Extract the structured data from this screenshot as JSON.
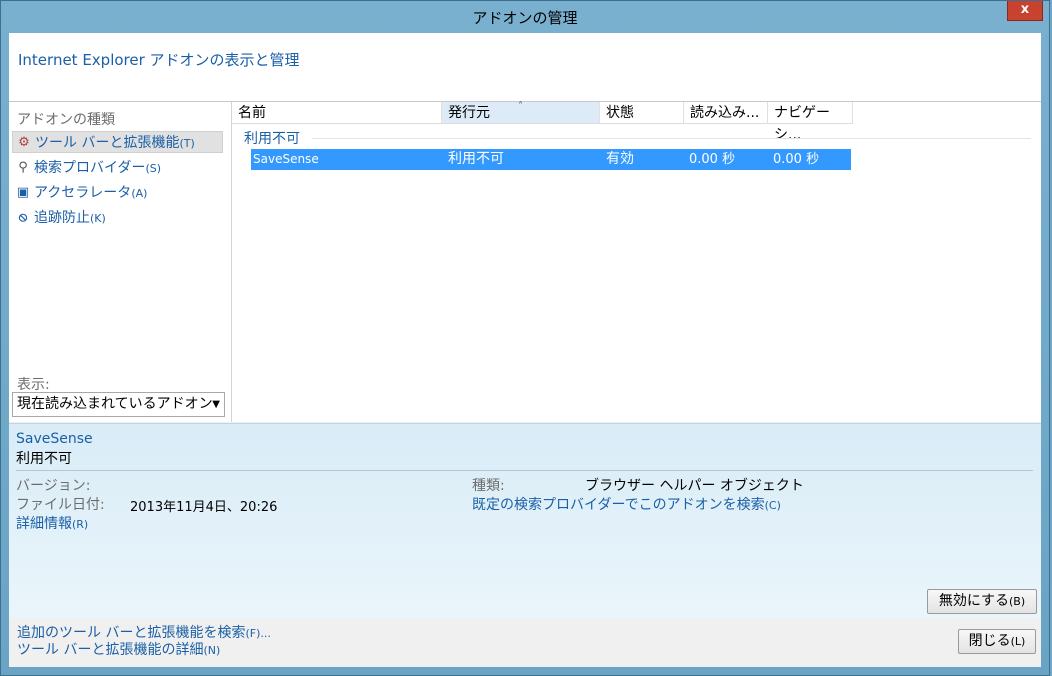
{
  "window": {
    "title": "アドオンの管理",
    "close_label": "x"
  },
  "header": {
    "title": "Internet Explorer アドオンの表示と管理"
  },
  "sidebar": {
    "heading": "アドオンの種類",
    "items": [
      {
        "label": "ツール バーと拡張機能",
        "accel": "(T)",
        "icon": "toolbar-extension-icon",
        "glyph": "⚙"
      },
      {
        "label": "検索プロバイダー",
        "accel": "(S)",
        "icon": "search-icon",
        "glyph": "⚲"
      },
      {
        "label": "アクセラレータ",
        "accel": "(A)",
        "icon": "accelerator-icon",
        "glyph": "▣"
      },
      {
        "label": "追跡防止",
        "accel": "(K)",
        "icon": "tracking-protection-icon",
        "glyph": "⦸"
      }
    ],
    "show_label": "表示:",
    "show_value": "現在読み込まれているアドオン"
  },
  "list": {
    "columns": [
      "名前",
      "発行元",
      "状態",
      "読み込み...",
      "ナビゲーシ..."
    ],
    "sorted_column": "発行元",
    "group": "利用不可",
    "rows": [
      {
        "name": "SaveSense",
        "publisher": "利用不可",
        "status": "有効",
        "load_time": "0.00 秒",
        "nav_time": "0.00 秒"
      }
    ]
  },
  "details": {
    "name": "SaveSense",
    "status": "利用不可",
    "version_label": "バージョン:",
    "version_value": "",
    "file_date_label": "ファイル日付:",
    "file_date_value": "2013年11月4日、20:26",
    "more_info_link": "詳細情報",
    "more_info_accel": "(R)",
    "type_label": "種類:",
    "type_value": "ブラウザー ヘルパー オブジェクト",
    "search_link": "既定の検索プロバイダーでこのアドオンを検索",
    "search_accel": "(C)",
    "disable_button": "無効にする",
    "disable_accel": "(B)"
  },
  "footer": {
    "find_more_link": "追加のツール バーと拡張機能を検索",
    "find_more_accel": "(F)...",
    "learn_more_link": "ツール バーと拡張機能の詳細",
    "learn_more_accel": "(N)",
    "close_button": "閉じる",
    "close_accel": "(L)"
  },
  "colors": {
    "accent": "#1b5fa6",
    "selection": "#3399ff",
    "title_close": "#c7422f"
  }
}
